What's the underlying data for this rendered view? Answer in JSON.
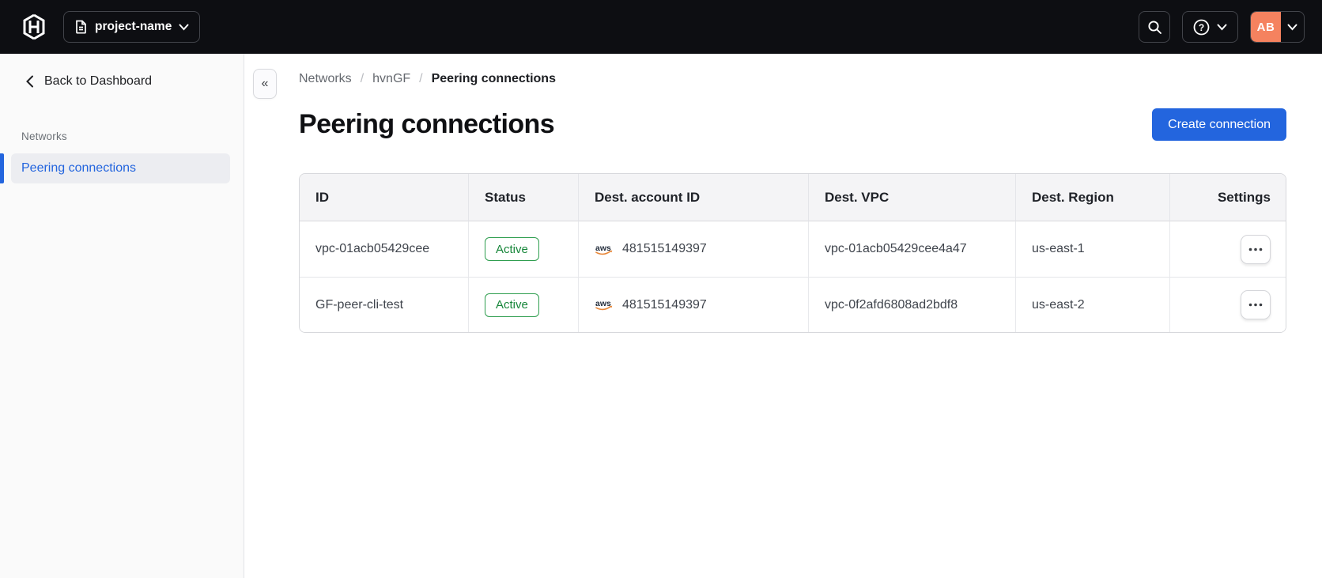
{
  "colors": {
    "topbar_bg": "#0d0e12",
    "accent_blue": "#2365de",
    "success_green": "#2f9e4f",
    "avatar_orange": "#f5825f"
  },
  "icons": {
    "collapse_glyph": "«",
    "help_glyph": "?",
    "aws_label": "aws",
    "breadcrumb_separator": "/"
  },
  "topbar": {
    "project_button_label": "project-name",
    "avatar_initials": "AB"
  },
  "sidebar": {
    "back_label": "Back to Dashboard",
    "section_label": "Networks",
    "active_item_label": "Peering connections"
  },
  "breadcrumb": {
    "items": [
      "Networks",
      "hvnGF",
      "Peering connections"
    ]
  },
  "page": {
    "title": "Peering connections",
    "create_button_label": "Create connection"
  },
  "table": {
    "columns": [
      "ID",
      "Status",
      "Dest. account ID",
      "Dest. VPC",
      "Dest. Region",
      "Settings"
    ],
    "rows": [
      {
        "id": "vpc-01acb05429cee",
        "status": "Active",
        "dest_account_id": "481515149397",
        "dest_vpc": "vpc-01acb05429cee4a47",
        "dest_region": "us-east-1"
      },
      {
        "id": "GF-peer-cli-test",
        "status": "Active",
        "dest_account_id": "481515149397",
        "dest_vpc": "vpc-0f2afd6808ad2bdf8",
        "dest_region": "us-east-2"
      }
    ]
  }
}
